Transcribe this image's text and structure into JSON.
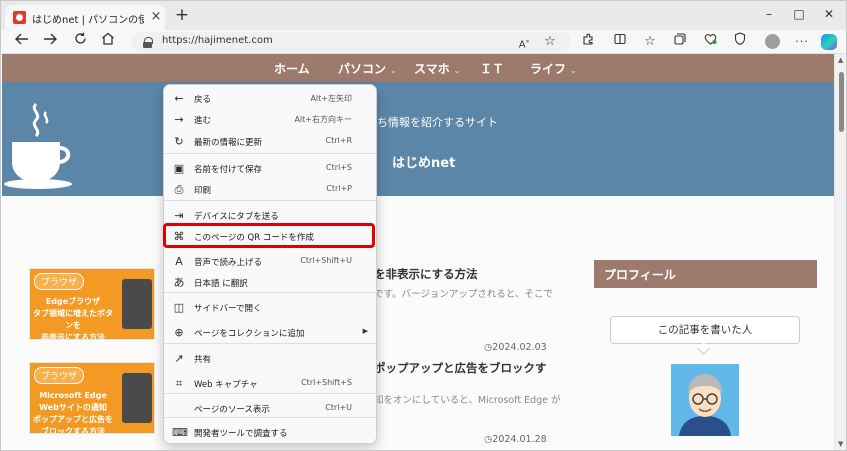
{
  "browser": {
    "tab": {
      "title": "はじめnet | パソコンの使い方やお役立",
      "close": "×"
    },
    "new_tab": "+",
    "window_controls": {
      "minimize": "–",
      "maximize": "□",
      "close": "✕"
    },
    "url": "https://hajimenet.com"
  },
  "site": {
    "nav": [
      {
        "label": "ホーム",
        "caret": ""
      },
      {
        "label": "パソコン",
        "caret": "⌄"
      },
      {
        "label": "スマホ",
        "caret": "⌄"
      },
      {
        "label": "ＩＴ",
        "caret": ""
      },
      {
        "label": "ライフ",
        "caret": "⌄"
      }
    ],
    "tagline": "方やお役立ち情報を紹介するサイト",
    "title": "はじめnet"
  },
  "articles": [
    {
      "badge": "ブラウザ",
      "thumb_text": "Edgeブラウザ\nタブ領域に増えたボタンを\n非表示にする方法",
      "title": "を非表示にする方法",
      "excerpt": "です。バージョンアップされると、そこで",
      "date": "2024.02.03"
    },
    {
      "badge": "ブラウザ",
      "thumb_text": "Microsoft Edge\nWebサイトの通知\nポップアップと広告をブロックする方法",
      "title": "ポップアップと広告をブロックす",
      "excerpt": "知をオンにしていると、Microsoft Edge が",
      "date": "2024.01.28"
    }
  ],
  "sidebar": {
    "profile_heading": "プロフィール",
    "bubble_text": "この記事を書いた人"
  },
  "context_menu": {
    "items": [
      {
        "icon": "back-icon",
        "glyph": "←",
        "label": "戻る",
        "shortcut": "Alt+左矢印"
      },
      {
        "icon": "forward-icon",
        "glyph": "→",
        "label": "進む",
        "shortcut": "Alt+右方向キー"
      },
      {
        "icon": "refresh-icon",
        "glyph": "↻",
        "label": "最新の情報に更新",
        "shortcut": "Ctrl+R"
      },
      {
        "icon": "save-icon",
        "glyph": "▣",
        "label": "名前を付けて保存",
        "shortcut": "Ctrl+S"
      },
      {
        "icon": "print-icon",
        "glyph": "⎙",
        "label": "印刷",
        "shortcut": "Ctrl+P"
      },
      {
        "icon": "send-tab-icon",
        "glyph": "⇥",
        "label": "デバイスにタブを送る",
        "shortcut": ""
      },
      {
        "icon": "qr-code-icon",
        "glyph": "⌘",
        "label": "このページの QR コードを作成",
        "shortcut": ""
      },
      {
        "icon": "read-aloud-icon",
        "glyph": "A",
        "label": "音声で読み上げる",
        "shortcut": "Ctrl+Shift+U"
      },
      {
        "icon": "translate-icon",
        "glyph": "あ",
        "label": "日本語 に翻訳",
        "shortcut": ""
      },
      {
        "icon": "sidebar-icon",
        "glyph": "◫",
        "label": "サイドバーで開く",
        "shortcut": ""
      },
      {
        "icon": "collection-icon",
        "glyph": "⊕",
        "label": "ページをコレクションに追加",
        "shortcut": "",
        "arrow": "▶"
      },
      {
        "icon": "share-icon",
        "glyph": "↗",
        "label": "共有",
        "shortcut": ""
      },
      {
        "icon": "web-capture-icon",
        "glyph": "⌗",
        "label": "Web キャプチャ",
        "shortcut": "Ctrl+Shift+S"
      },
      {
        "icon": "",
        "glyph": "",
        "label": "ページのソース表示",
        "shortcut": "Ctrl+U"
      },
      {
        "icon": "dev-tools-icon",
        "glyph": "⌨",
        "label": "開発者ツールで調査する",
        "shortcut": ""
      }
    ]
  },
  "colors": {
    "nav_bg": "#9c7b6d",
    "hero_bg": "#5b86a8",
    "highlight": "#e00000",
    "thumb_bg": "#f39a24"
  }
}
